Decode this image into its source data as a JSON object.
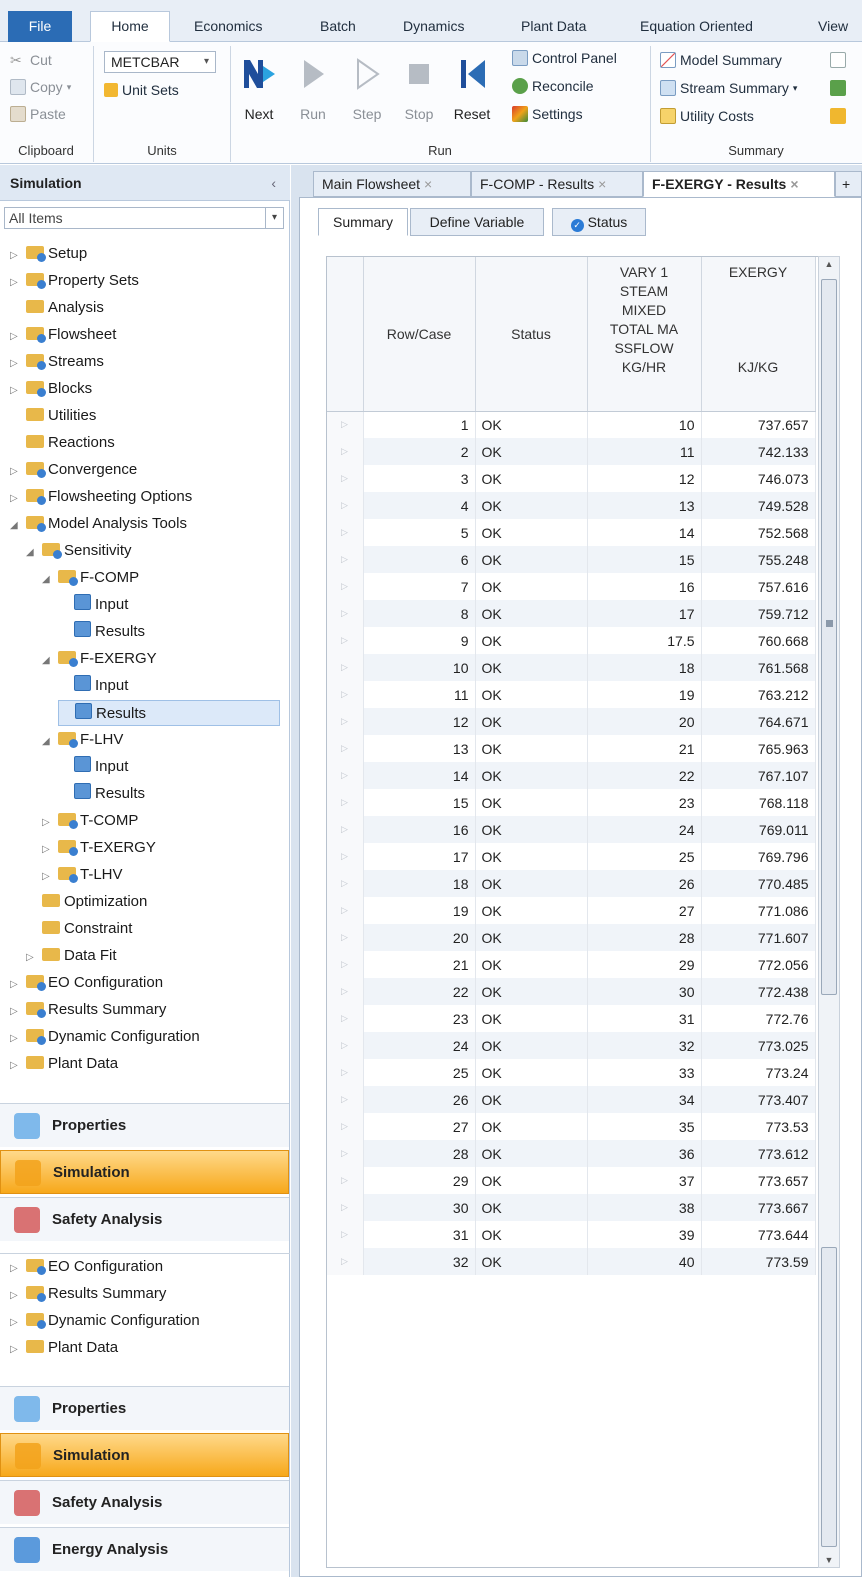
{
  "ribbon": {
    "tabs": [
      "File",
      "Home",
      "Economics",
      "Batch",
      "Dynamics",
      "Plant Data",
      "Equation Oriented",
      "View"
    ],
    "clipboard": {
      "cut": "Cut",
      "copy": "Copy",
      "paste": "Paste",
      "label": "Clipboard"
    },
    "units": {
      "selected": "METCBAR",
      "unit_sets": "Unit Sets",
      "label": "Units"
    },
    "run": {
      "next": "Next",
      "run": "Run",
      "step": "Step",
      "stop": "Stop",
      "reset": "Reset",
      "control_panel": "Control Panel",
      "reconcile": "Reconcile",
      "settings": "Settings",
      "label": "Run"
    },
    "summary": {
      "model_summary": "Model Summary",
      "stream_summary": "Stream Summary",
      "utility_costs": "Utility Costs",
      "label": "Summary"
    }
  },
  "left": {
    "title": "Simulation",
    "collapse": "‹",
    "filter": "All Items",
    "tree": [
      {
        "label": "Setup",
        "depth": 0,
        "exp": "▷",
        "icon": "bl"
      },
      {
        "label": "Property Sets",
        "depth": 0,
        "exp": "▷",
        "icon": "bl"
      },
      {
        "label": "Analysis",
        "depth": 0,
        "exp": "",
        "icon": ""
      },
      {
        "label": "Flowsheet",
        "depth": 0,
        "exp": "▷",
        "icon": "bl"
      },
      {
        "label": "Streams",
        "depth": 0,
        "exp": "▷",
        "icon": "bl"
      },
      {
        "label": "Blocks",
        "depth": 0,
        "exp": "▷",
        "icon": "bl"
      },
      {
        "label": "Utilities",
        "depth": 0,
        "exp": "",
        "icon": ""
      },
      {
        "label": "Reactions",
        "depth": 0,
        "exp": "",
        "icon": ""
      },
      {
        "label": "Convergence",
        "depth": 0,
        "exp": "▷",
        "icon": "bl"
      },
      {
        "label": "Flowsheeting Options",
        "depth": 0,
        "exp": "▷",
        "icon": "bl"
      },
      {
        "label": "Model Analysis Tools",
        "depth": 0,
        "exp": "◢",
        "icon": "bl"
      },
      {
        "label": "Sensitivity",
        "depth": 1,
        "exp": "◢",
        "icon": "bl"
      },
      {
        "label": "F-COMP",
        "depth": 2,
        "exp": "◢",
        "icon": "bl"
      },
      {
        "label": "Input",
        "depth": 3,
        "exp": "",
        "icon": "doc"
      },
      {
        "label": "Results",
        "depth": 3,
        "exp": "",
        "icon": "doc"
      },
      {
        "label": "F-EXERGY",
        "depth": 2,
        "exp": "◢",
        "icon": "bl"
      },
      {
        "label": "Input",
        "depth": 3,
        "exp": "",
        "icon": "doc"
      },
      {
        "label": "Results",
        "depth": 3,
        "exp": "",
        "icon": "doc",
        "selected": true
      },
      {
        "label": "F-LHV",
        "depth": 2,
        "exp": "◢",
        "icon": "bl"
      },
      {
        "label": "Input",
        "depth": 3,
        "exp": "",
        "icon": "doc"
      },
      {
        "label": "Results",
        "depth": 3,
        "exp": "",
        "icon": "doc"
      },
      {
        "label": "T-COMP",
        "depth": 2,
        "exp": "▷",
        "icon": "bl"
      },
      {
        "label": "T-EXERGY",
        "depth": 2,
        "exp": "▷",
        "icon": "bl"
      },
      {
        "label": "T-LHV",
        "depth": 2,
        "exp": "▷",
        "icon": "bl"
      },
      {
        "label": "Optimization",
        "depth": 1,
        "exp": "",
        "icon": ""
      },
      {
        "label": "Constraint",
        "depth": 1,
        "exp": "",
        "icon": ""
      },
      {
        "label": "Data Fit",
        "depth": 1,
        "exp": "▷",
        "icon": ""
      },
      {
        "label": "EO Configuration",
        "depth": 0,
        "exp": "▷",
        "icon": "bl"
      },
      {
        "label": "Results Summary",
        "depth": 0,
        "exp": "▷",
        "icon": "bl"
      },
      {
        "label": "Dynamic Configuration",
        "depth": 0,
        "exp": "▷",
        "icon": "bl"
      },
      {
        "label": "Plant Data",
        "depth": 0,
        "exp": "▷",
        "icon": ""
      }
    ],
    "tree2": [
      {
        "label": "EO Configuration",
        "depth": 0,
        "exp": "▷",
        "icon": "bl"
      },
      {
        "label": "Results Summary",
        "depth": 0,
        "exp": "▷",
        "icon": "bl"
      },
      {
        "label": "Dynamic Configuration",
        "depth": 0,
        "exp": "▷",
        "icon": "bl"
      },
      {
        "label": "Plant Data",
        "depth": 0,
        "exp": "▷",
        "icon": ""
      }
    ],
    "nav1": [
      "Properties",
      "Simulation",
      "Safety Analysis"
    ],
    "nav2": [
      "Properties",
      "Simulation",
      "Safety Analysis",
      "Energy Analysis"
    ]
  },
  "doc_tabs": [
    "Main Flowsheet",
    "F-COMP - Results",
    "F-EXERGY - Results"
  ],
  "doc_tab_add": "+",
  "sub_tabs": [
    "Summary",
    "Define Variable",
    "Status"
  ],
  "table": {
    "headers": {
      "row_case": "Row/Case",
      "status": "Status",
      "vary": [
        "VARY  1",
        "STEAM",
        "MIXED",
        "TOTAL MA",
        "SSFLOW",
        "KG/HR"
      ],
      "exergy": "EXERGY",
      "exergy_unit": "KJ/KG"
    },
    "rows": [
      [
        "1",
        "OK",
        "10",
        "737.657"
      ],
      [
        "2",
        "OK",
        "11",
        "742.133"
      ],
      [
        "3",
        "OK",
        "12",
        "746.073"
      ],
      [
        "4",
        "OK",
        "13",
        "749.528"
      ],
      [
        "5",
        "OK",
        "14",
        "752.568"
      ],
      [
        "6",
        "OK",
        "15",
        "755.248"
      ],
      [
        "7",
        "OK",
        "16",
        "757.616"
      ],
      [
        "8",
        "OK",
        "17",
        "759.712"
      ],
      [
        "9",
        "OK",
        "17.5",
        "760.668"
      ],
      [
        "10",
        "OK",
        "18",
        "761.568"
      ],
      [
        "11",
        "OK",
        "19",
        "763.212"
      ],
      [
        "12",
        "OK",
        "20",
        "764.671"
      ],
      [
        "13",
        "OK",
        "21",
        "765.963"
      ],
      [
        "14",
        "OK",
        "22",
        "767.107"
      ],
      [
        "15",
        "OK",
        "23",
        "768.118"
      ],
      [
        "16",
        "OK",
        "24",
        "769.011"
      ],
      [
        "17",
        "OK",
        "25",
        "769.796"
      ],
      [
        "18",
        "OK",
        "26",
        "770.485"
      ],
      [
        "19",
        "OK",
        "27",
        "771.086"
      ],
      [
        "20",
        "OK",
        "28",
        "771.607"
      ],
      [
        "21",
        "OK",
        "29",
        "772.056"
      ],
      [
        "22",
        "OK",
        "30",
        "772.438"
      ],
      [
        "23",
        "OK",
        "31",
        "772.76"
      ],
      [
        "24",
        "OK",
        "32",
        "773.025"
      ],
      [
        "25",
        "OK",
        "33",
        "773.24"
      ],
      [
        "26",
        "OK",
        "34",
        "773.407"
      ],
      [
        "27",
        "OK",
        "35",
        "773.53"
      ],
      [
        "28",
        "OK",
        "36",
        "773.612"
      ],
      [
        "29",
        "OK",
        "37",
        "773.657"
      ],
      [
        "30",
        "OK",
        "38",
        "773.667"
      ],
      [
        "31",
        "OK",
        "39",
        "773.644"
      ],
      [
        "32",
        "OK",
        "40",
        "773.59"
      ]
    ]
  }
}
